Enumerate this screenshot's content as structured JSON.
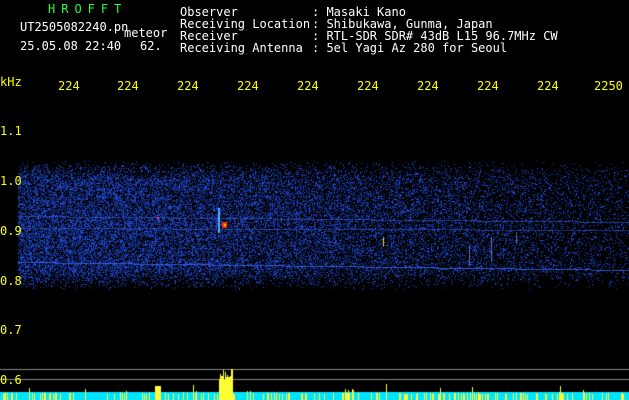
{
  "brand": "HROFFT",
  "filename": "UT2505082240.pn",
  "filename_suffix": "meteor",
  "timestamp": "25.05.08 22:40",
  "count": "62.",
  "info": [
    {
      "label": "Observer",
      "value": ": Masaki Kano"
    },
    {
      "label": "Receiving Location",
      "value": ": Shibukawa, Gunma, Japan"
    },
    {
      "label": "Receiver",
      "value": ": RTL-SDR SDR# 43dB L15 96.7MHz CW"
    },
    {
      "label": "Receiving Antenna",
      "value": ": 5el Yagi Az 280 for Seoul"
    }
  ],
  "axis": {
    "unit": "kHz",
    "time_labels": [
      "224",
      "224",
      "224",
      "224",
      "224",
      "224",
      "224",
      "224",
      "224",
      "2250"
    ],
    "freq_labels": [
      "1.1",
      "1.0",
      "0.9",
      "0.8",
      "0.7",
      "0.6"
    ]
  },
  "colors": {
    "background": "#000000",
    "text": "#ffffff",
    "brand": "#22ff33",
    "axis": "#ffff00",
    "signal": "#1a3cff",
    "baseline": "#00e5ff"
  }
}
